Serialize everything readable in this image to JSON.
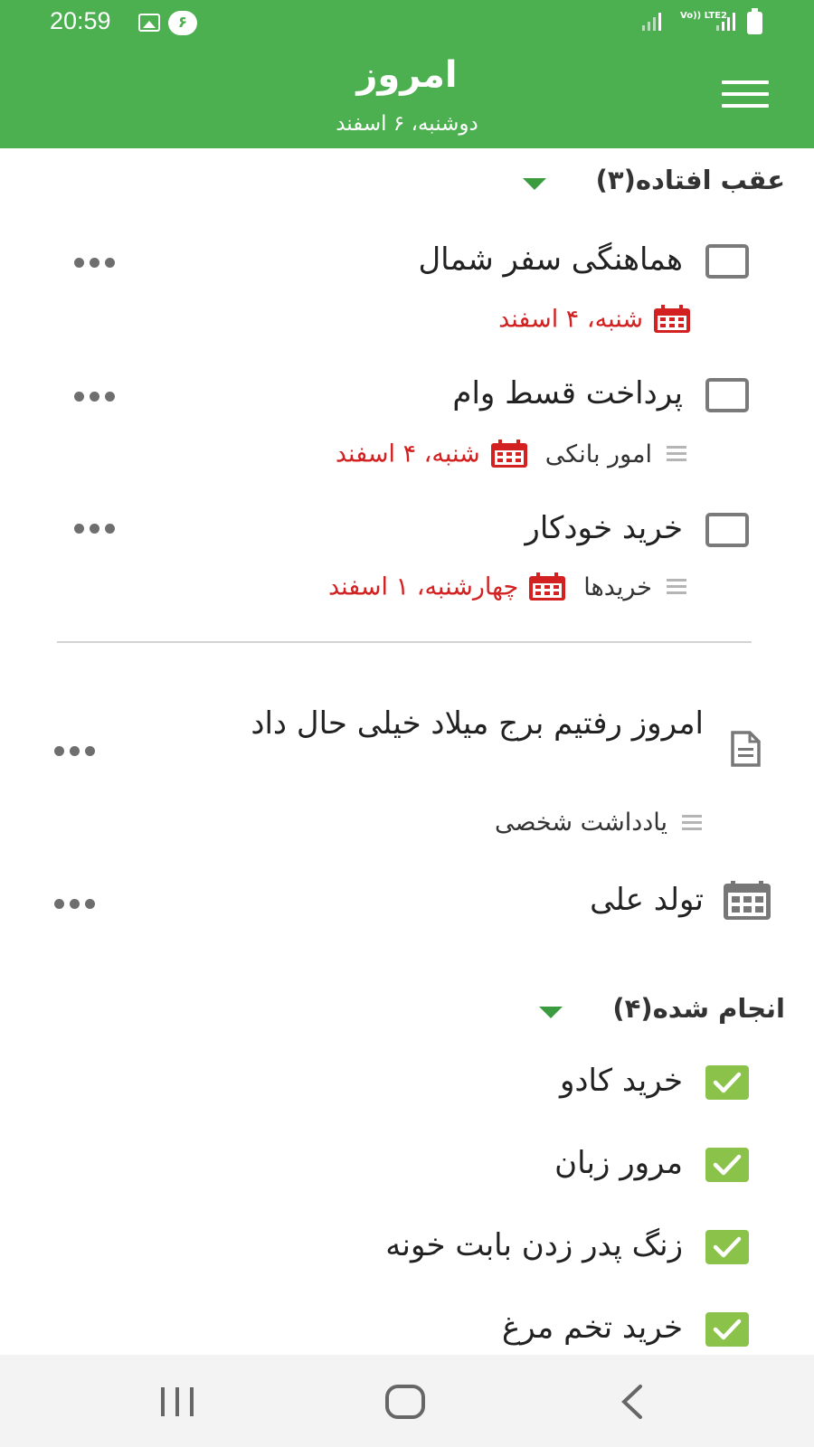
{
  "status_bar": {
    "time": "20:59",
    "badge": "۶",
    "network": "Vo)) LTE2",
    "icons": [
      "image-icon",
      "signal-icon",
      "signal-icon",
      "battery-icon"
    ]
  },
  "header": {
    "title": "امروز",
    "subtitle": "دوشنبه، ۶ اسفند",
    "menu_icon": "hamburger-menu-icon"
  },
  "overdue": {
    "label": "عقب افتاده(۳)",
    "tasks": [
      {
        "title": "هماهنگی سفر شمال",
        "list": "",
        "due": "شنبه، ۴ اسفند"
      },
      {
        "title": "پرداخت قسط وام",
        "list": "امور بانکی",
        "due": "شنبه، ۴ اسفند"
      },
      {
        "title": "خرید خودکار",
        "list": "خریدها",
        "due": "چهارشنبه، ۱ اسفند"
      }
    ]
  },
  "note": {
    "title": "امروز رفتیم برج میلاد خیلی حال داد",
    "list": "یادداشت شخصی",
    "icon": "document-icon"
  },
  "event": {
    "title": "تولد علی",
    "icon": "calendar-event-icon"
  },
  "completed": {
    "label": "انجام شده(۴)",
    "tasks": [
      "خرید کادو",
      "مرور زبان",
      "زنگ پدر زدن بابت خونه",
      "خرید تخم مرغ"
    ]
  },
  "colors": {
    "primary": "#4caf50",
    "overdue": "#d32020",
    "done": "#8bc34a"
  },
  "nav_bar": [
    "recents-icon",
    "home-icon",
    "back-icon"
  ]
}
